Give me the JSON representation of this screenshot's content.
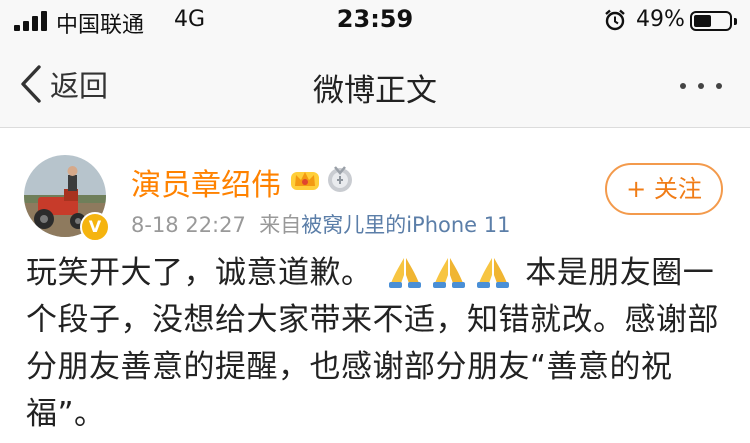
{
  "status_bar": {
    "carrier": "中国联通",
    "network": "4G",
    "time": "23:59",
    "battery_percent": "49%",
    "battery_level": 0.49
  },
  "nav": {
    "back_label": "返回",
    "title": "微博正文"
  },
  "post": {
    "author": "演员章绍伟",
    "date": "8-18 22:27",
    "source_prefix": "来自",
    "source_device": "被窝儿里的iPhone 11",
    "verified_badge": "V",
    "follow_label": "+ 关注",
    "text_part1": "玩笑开大了，诚意道歉。",
    "emojis": [
      "folded-hands",
      "folded-hands",
      "folded-hands"
    ],
    "text_part2": "本是朋友圈一个段子，没想给大家带来不适，知错就改。感谢部分朋友善意的提醒，也感谢部分朋友“善意的祝福”。"
  },
  "colors": {
    "accent": "#ff8200",
    "follow_border": "#f39a4c",
    "meta": "#999999",
    "device_link": "#5b7ea8"
  }
}
